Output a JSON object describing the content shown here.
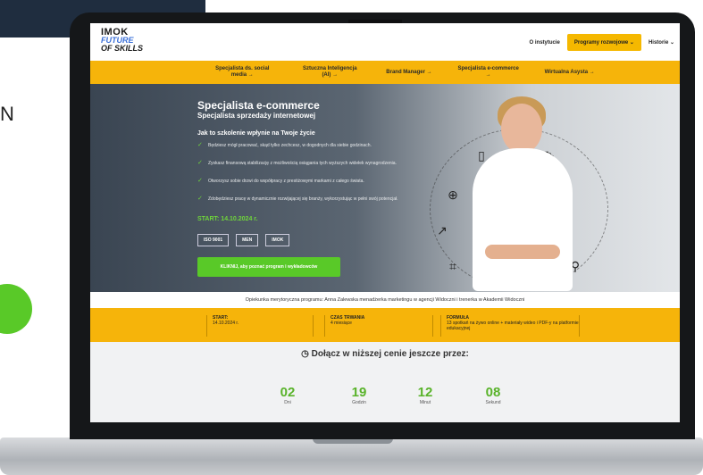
{
  "backdrop": {
    "left_text": "N"
  },
  "header": {
    "logo": [
      "IMOK",
      "FUTURE",
      "OF SKILLS"
    ],
    "links": [
      "O instytucie",
      "Programy rozwojowe",
      "Historie"
    ]
  },
  "menu": [
    "Specjalista ds. social media",
    "Sztuczna Inteligencja (AI)",
    "Brand Manager",
    "Specjalista e-commerce",
    "Wirtualna Asysta"
  ],
  "hero": {
    "title": "Specjalista e-commerce",
    "subtitle": "Specjalista sprzedaży internetowej",
    "question": "Jak to szkolenie wpłynie na Twoje życie",
    "bullets": [
      "Będziesz mógł pracować, skąd tylko zechcesz, w dogodnych dla siebie godzinach.",
      "Zyskasz finansową stabilizację z możliwością osiągania tych wyższych widełek wynagrodzenia.",
      "Otworzysz sobie drzwi do współpracy z prestiżowymi markami z całego świata.",
      "Zdobędziesz pracę w dynamicznie rozwijającej się branży, wykorzystując w pełni swój potencjał."
    ],
    "start": "START: 14.10.2024 r.",
    "badges": [
      "ISO 9001",
      "MEN",
      "IMOK"
    ],
    "cta": "KLIKNIJ, aby poznać program i wykładowców"
  },
  "caption": "Opiekunka merytoryczna programu: Anna Zalewska menadżerka marketingu w agencji Widoczni i trenerka w Akademii Widoczni",
  "info": [
    {
      "label": "START:",
      "value": "14.10.2024 r."
    },
    {
      "label": "CZAS TRWANIA",
      "value": "4 miesiące"
    },
    {
      "label": "FORMUŁA",
      "value": "13 spotkań na żywo online + materiały wideo i PDF-y na platformie edukacyjnej"
    }
  ],
  "countdown": {
    "title": "Dołącz w niższej cenie jeszcze przez:",
    "items": [
      {
        "value": "02",
        "unit": "Dni"
      },
      {
        "value": "19",
        "unit": "Godzin"
      },
      {
        "value": "12",
        "unit": "Minut"
      },
      {
        "value": "08",
        "unit": "Sekund"
      }
    ]
  }
}
